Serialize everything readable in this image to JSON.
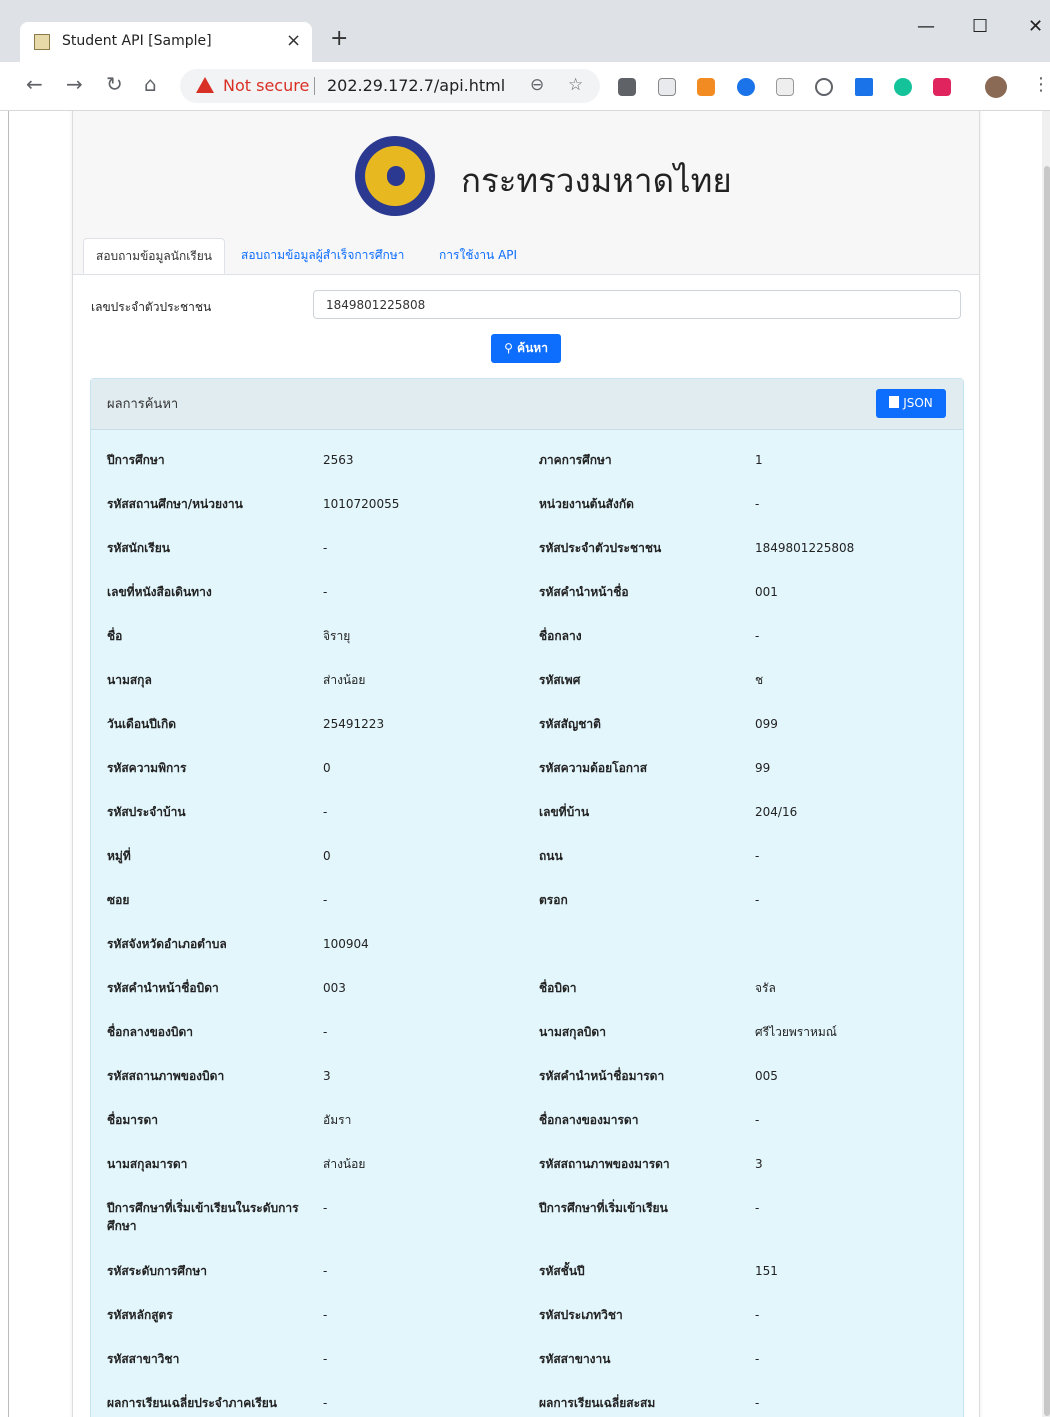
{
  "browser": {
    "tab_title": "Student API [Sample]",
    "tab_close": "×",
    "new_tab": "+",
    "window_minimize": "—",
    "window_maximize": "☐",
    "window_close": "✕",
    "security_label": "Not secure",
    "url": "202.29.172.7/api.html"
  },
  "header": {
    "title": "กระทรวงมหาดไทย"
  },
  "tabs": [
    {
      "label": "สอบถามข้อมูลนักเรียน"
    },
    {
      "label": "สอบถามข้อมูลผู้สำเร็จการศึกษา"
    },
    {
      "label": "การใช้งาน API"
    }
  ],
  "search": {
    "label": "เลขประจำตัวประชาชน",
    "value": "1849801225808",
    "button_label": "ค้นหา",
    "button_icon": "search-icon"
  },
  "results": {
    "title": "ผลการค้นหา",
    "json_button": "JSON",
    "rows": [
      {
        "l1": "ปีการศึกษา",
        "v1": "2563",
        "l2": "ภาคการศึกษา",
        "v2": "1"
      },
      {
        "l1": "รหัสสถานศึกษา/หน่วยงาน",
        "v1": "1010720055",
        "l2": "หน่วยงานต้นสังกัด",
        "v2": "-"
      },
      {
        "l1": "รหัสนักเรียน",
        "v1": "-",
        "l2": "รหัสประจำตัวประชาชน",
        "v2": "1849801225808"
      },
      {
        "l1": "เลขที่หนังสือเดินทาง",
        "v1": "-",
        "l2": "รหัสคำนำหน้าชื่อ",
        "v2": "001"
      },
      {
        "l1": "ชื่อ",
        "v1": "จิรายุ",
        "l2": "ชื่อกลาง",
        "v2": "-"
      },
      {
        "l1": "นามสกุล",
        "v1": "ส่างน้อย",
        "l2": "รหัสเพศ",
        "v2": "ช"
      },
      {
        "l1": "วันเดือนปีเกิด",
        "v1": "25491223",
        "l2": "รหัสสัญชาติ",
        "v2": "099"
      },
      {
        "l1": "รหัสความพิการ",
        "v1": "0",
        "l2": "รหัสความด้อยโอกาส",
        "v2": "99"
      },
      {
        "l1": "รหัสประจำบ้าน",
        "v1": "-",
        "l2": "เลขที่บ้าน",
        "v2": "204/16"
      },
      {
        "l1": "หมู่ที่",
        "v1": "0",
        "l2": "ถนน",
        "v2": "-"
      },
      {
        "l1": "ซอย",
        "v1": "-",
        "l2": "ตรอก",
        "v2": "-"
      },
      {
        "l1": "รหัสจังหวัดอำเภอตำบล",
        "v1": "100904",
        "l2": "",
        "v2": ""
      },
      {
        "l1": "รหัสคำนำหน้าชื่อบิดา",
        "v1": "003",
        "l2": "ชื่อบิดา",
        "v2": "จรัล"
      },
      {
        "l1": "ชื่อกลางของบิดา",
        "v1": "-",
        "l2": "นามสกุลบิดา",
        "v2": "ศรีไวยพราหมณ์"
      },
      {
        "l1": "รหัสสถานภาพของบิดา",
        "v1": "3",
        "l2": "รหัสคำนำหน้าชื่อมารดา",
        "v2": "005"
      },
      {
        "l1": "ชื่อมารดา",
        "v1": "อัมรา",
        "l2": "ชื่อกลางของมารดา",
        "v2": "-"
      },
      {
        "l1": "นามสกุลมารดา",
        "v1": "ส่างน้อย",
        "l2": "รหัสสถานภาพของมารดา",
        "v2": "3"
      },
      {
        "l1": "ปีการศึกษาที่เริ่มเข้าเรียนในระดับการศึกษา",
        "v1": "-",
        "l2": "ปีการศึกษาที่เริ่มเข้าเรียน",
        "v2": "-"
      },
      {
        "l1": "รหัสระดับการศึกษา",
        "v1": "-",
        "l2": "รหัสชั้นปี",
        "v2": "151"
      },
      {
        "l1": "รหัสหลักสูตร",
        "v1": "-",
        "l2": "รหัสประเภทวิชา",
        "v2": "-"
      },
      {
        "l1": "รหัสสาขาวิชา",
        "v1": "-",
        "l2": "รหัสสาขางาน",
        "v2": "-"
      },
      {
        "l1": "ผลการเรียนเฉลี่ยประจำภาคเรียน",
        "v1": "-",
        "l2": "ผลการเรียนเฉลี่ยสะสม",
        "v2": "-"
      }
    ]
  }
}
